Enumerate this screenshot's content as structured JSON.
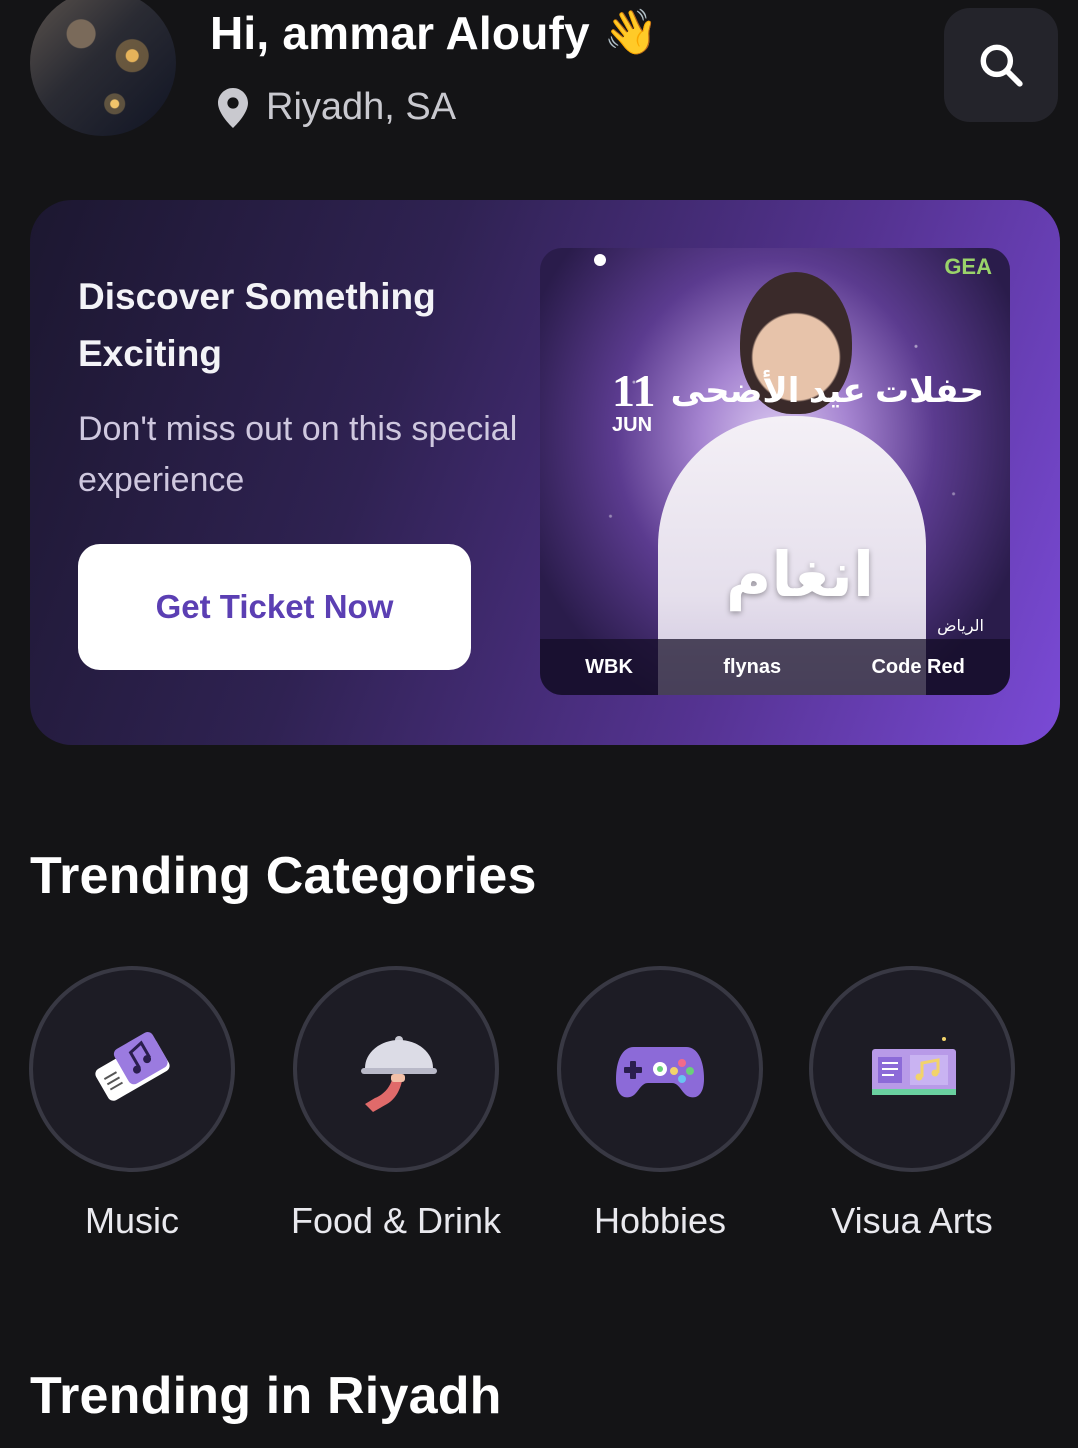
{
  "header": {
    "greeting": "Hi, ammar Aloufy",
    "wave_emoji": "👋",
    "location": "Riyadh, SA"
  },
  "banner": {
    "title": "Discover Something Exciting",
    "subtitle": "Don't miss out on this special experience",
    "button_label": "Get Ticket Now",
    "poster": {
      "date_day": "11",
      "date_month": "JUN",
      "title_ar": "انغام",
      "side_ar": "حفلات عيد الأضحى",
      "city_ar": "الرياض",
      "logo_corner": "GEA",
      "sponsors": [
        "WBK",
        "flynas",
        "Code Red"
      ]
    }
  },
  "trending_categories": {
    "title": "Trending Categories",
    "items": [
      {
        "label": "Music",
        "icon": "music-ticket-icon"
      },
      {
        "label": "Food & Drink",
        "icon": "food-cloche-icon"
      },
      {
        "label": "Hobbies",
        "icon": "gamepad-icon"
      },
      {
        "label": "Visua Arts",
        "icon": "art-board-icon"
      }
    ]
  },
  "trending_city": {
    "title": "Trending in Riyadh"
  },
  "colors": {
    "background": "#141416",
    "accent": "#7a4ad6",
    "button_text": "#5b3fb3"
  }
}
